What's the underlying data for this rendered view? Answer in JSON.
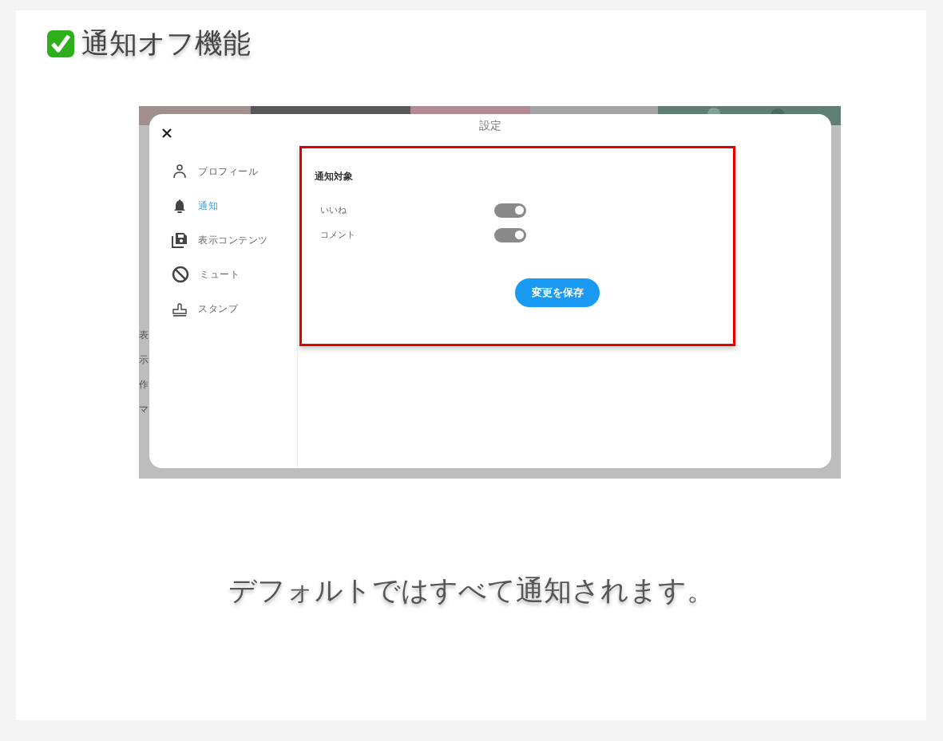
{
  "heading": {
    "text": "通知オフ機能"
  },
  "screenshot": {
    "background_labels": [
      "表",
      "示",
      "作",
      "マ"
    ],
    "dialog": {
      "title": "設定",
      "nav": [
        {
          "label": "プロフィール",
          "kind": "person",
          "selected": false
        },
        {
          "label": "通知",
          "kind": "bell",
          "selected": true
        },
        {
          "label": "表示コンテンツ",
          "kind": "disk",
          "selected": false
        },
        {
          "label": "ミュート",
          "kind": "block",
          "selected": false
        },
        {
          "label": "スタンプ",
          "kind": "stamp",
          "selected": false
        }
      ],
      "section_title": "通知対象",
      "toggles": [
        {
          "label": "いいね",
          "on": true
        },
        {
          "label": "コメント",
          "on": true
        }
      ],
      "save_button": "変更を保存"
    }
  },
  "caption": "デフォルトではすべて通知されます。"
}
